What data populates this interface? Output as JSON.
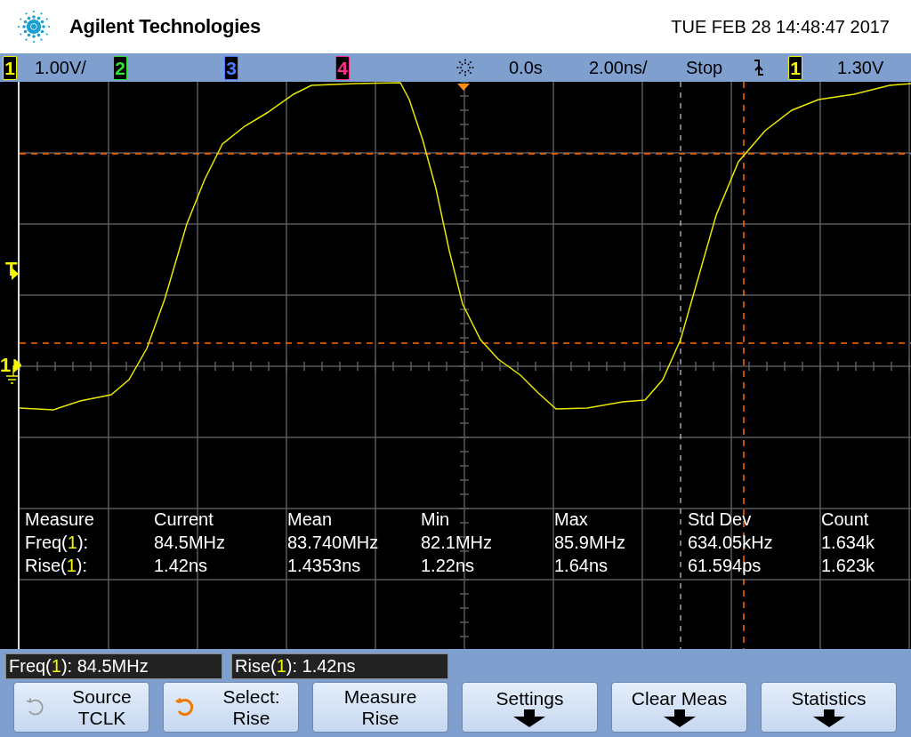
{
  "header": {
    "brand": "Agilent Technologies",
    "datetime": "TUE FEB 28 14:48:47 2017"
  },
  "channel_bar": {
    "channels": [
      {
        "number": "1",
        "scale": "1.00V/",
        "color": "#f5f500"
      },
      {
        "number": "2",
        "color": "#33e033"
      },
      {
        "number": "3",
        "color": "#4a7dff"
      },
      {
        "number": "4",
        "color": "#ff2f8f"
      }
    ],
    "delay": "0.0s",
    "timebase": "2.00ns/",
    "run_state": "Stop",
    "trigger_channel": {
      "number": "1",
      "color": "#f5f500"
    },
    "trigger_level": "1.30V"
  },
  "display": {
    "trigger_marker": "T",
    "ground_marker": "1",
    "measurements": {
      "columns": [
        "Measure",
        "Current",
        "Mean",
        "Min",
        "Max",
        "Std Dev",
        "Count"
      ],
      "rows": [
        {
          "name": "Freq(",
          "channel": "1",
          "suffix": "):",
          "values": [
            "84.5MHz",
            "83.740MHz",
            "82.1MHz",
            "85.9MHz",
            "634.05kHz",
            "1.634k"
          ]
        },
        {
          "name": "Rise(",
          "channel": "1",
          "suffix": "):",
          "values": [
            "1.42ns",
            "1.4353ns",
            "1.22ns",
            "1.64ns",
            "61.594ps",
            "1.623k"
          ]
        }
      ]
    }
  },
  "readouts": [
    {
      "name": "Freq(",
      "channel": "1",
      "suffix": "): 84.5MHz"
    },
    {
      "name": "Rise(",
      "channel": "1",
      "suffix": "): 1.42ns"
    }
  ],
  "softkeys": [
    {
      "kind": "knob",
      "line1": "Source",
      "line2": "TCLK",
      "enabled": false
    },
    {
      "kind": "knob",
      "line1": "Select:",
      "line2": "Rise",
      "enabled": true
    },
    {
      "kind": "plain",
      "line1": "Measure",
      "line2": "Rise"
    },
    {
      "kind": "menu",
      "line1": "Settings"
    },
    {
      "kind": "menu",
      "line1": "Clear Meas"
    },
    {
      "kind": "menu",
      "line1": "Statistics"
    }
  ]
}
